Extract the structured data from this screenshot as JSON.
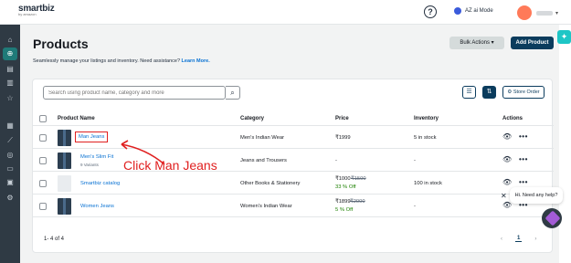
{
  "header": {
    "logo_text": "smartbiz",
    "logo_sub": "by amazon",
    "help_icon": "?",
    "mode_label": "AZ ai Mode"
  },
  "sidebar": {
    "icons": [
      "home-icon",
      "products-icon",
      "orders-icon",
      "reports-icon",
      "star-icon",
      "store-icon",
      "analytics-icon",
      "marketing-icon",
      "chat-icon",
      "payments-icon",
      "settings-icon"
    ]
  },
  "page": {
    "title": "Products",
    "subtitle": "Seamlessly manage your listings and inventory. Need assistance?",
    "learn_more": "Learn More.",
    "bulk_actions": "Bulk Actions",
    "bulk_chevron": "▾",
    "add_product": "Add Product"
  },
  "toolbar": {
    "search_placeholder": "Search using product name, category and more",
    "store_order": "Store Order"
  },
  "table": {
    "headers": {
      "product_name": "Product Name",
      "category": "Category",
      "price": "Price",
      "inventory": "Inventory",
      "actions": "Actions"
    },
    "rows": [
      {
        "name": "Man Jeans",
        "variants": "",
        "category": "Men's Indian Wear",
        "price": "₹1999",
        "mrp": "",
        "discount": "",
        "inventory": "5 in stock"
      },
      {
        "name": "Men's Slim Fit",
        "variants": "9 Variants",
        "category": "Jeans and Trousers",
        "price": "-",
        "mrp": "",
        "discount": "",
        "inventory": "-"
      },
      {
        "name": "Smartbiz catalog",
        "variants": "",
        "category": "Other Books & Stationery",
        "price": "₹1000",
        "mrp": "₹1500",
        "discount": "33 % Off",
        "inventory": "100 in stock"
      },
      {
        "name": "Women Jeans",
        "variants": "",
        "category": "Women's Indian Wear",
        "price": "₹1899",
        "mrp": "₹2000",
        "discount": "5 % Off",
        "inventory": "-"
      }
    ]
  },
  "footer": {
    "count": "1- 4 of 4",
    "prev": "‹",
    "page": "1",
    "next": "›"
  },
  "annotation": {
    "text": "Click Man Jeans",
    "color": "#e02020"
  },
  "chat": {
    "close": "✕",
    "message": "Hi. Need any help?"
  },
  "colors": {
    "sidebar_bg": "#2f3a44",
    "primary": "#0b3c5d",
    "link": "#0972d3",
    "accent": "#1ec6c6"
  }
}
